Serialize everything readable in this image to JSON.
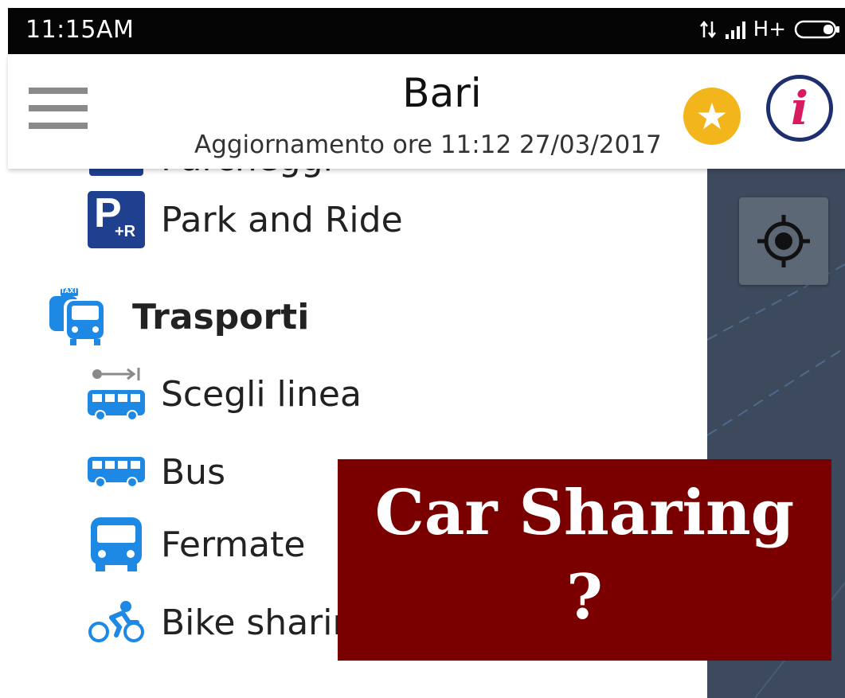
{
  "status_bar": {
    "time": "11:15AM",
    "network": "H+",
    "colors": {
      "background": "#050505",
      "text": "#ffffff"
    }
  },
  "header": {
    "title": "Bari",
    "subtitle": "Aggiornamento ore 11:12 27/03/2017",
    "favorite_icon": "star-icon",
    "info_icon": "info-icon",
    "colors": {
      "favorite": "#f2b51c",
      "info_ring": "#1d2f6f",
      "info_glyph": "#d81b60"
    }
  },
  "drawer": {
    "items": [
      {
        "label": "Parcheggi",
        "icon": "parking-icon"
      },
      {
        "label": "Park and Ride",
        "icon": "park-and-ride-icon",
        "icon_text": "P",
        "icon_subtext": "+R"
      },
      {
        "label": "Trasporti",
        "icon": "taxi-bus-icon",
        "icon_text": "TAXI",
        "section": true
      },
      {
        "label": "Scegli linea",
        "icon": "bus-line-icon"
      },
      {
        "label": "Bus",
        "icon": "bus-icon"
      },
      {
        "label": "Fermate",
        "icon": "bus-stop-icon"
      },
      {
        "label": "Bike sharing",
        "icon": "bike-icon"
      }
    ],
    "colors": {
      "parking_icon": "#1f3f8f",
      "transport_icon": "#1e88e5"
    }
  },
  "map": {
    "locate_icon": "crosshair-icon",
    "colors": {
      "background": "#3d4a5d"
    }
  },
  "overlay": {
    "line1": "Car Sharing",
    "line2": "?",
    "colors": {
      "background": "#7a0000",
      "text": "#ffffff"
    }
  }
}
